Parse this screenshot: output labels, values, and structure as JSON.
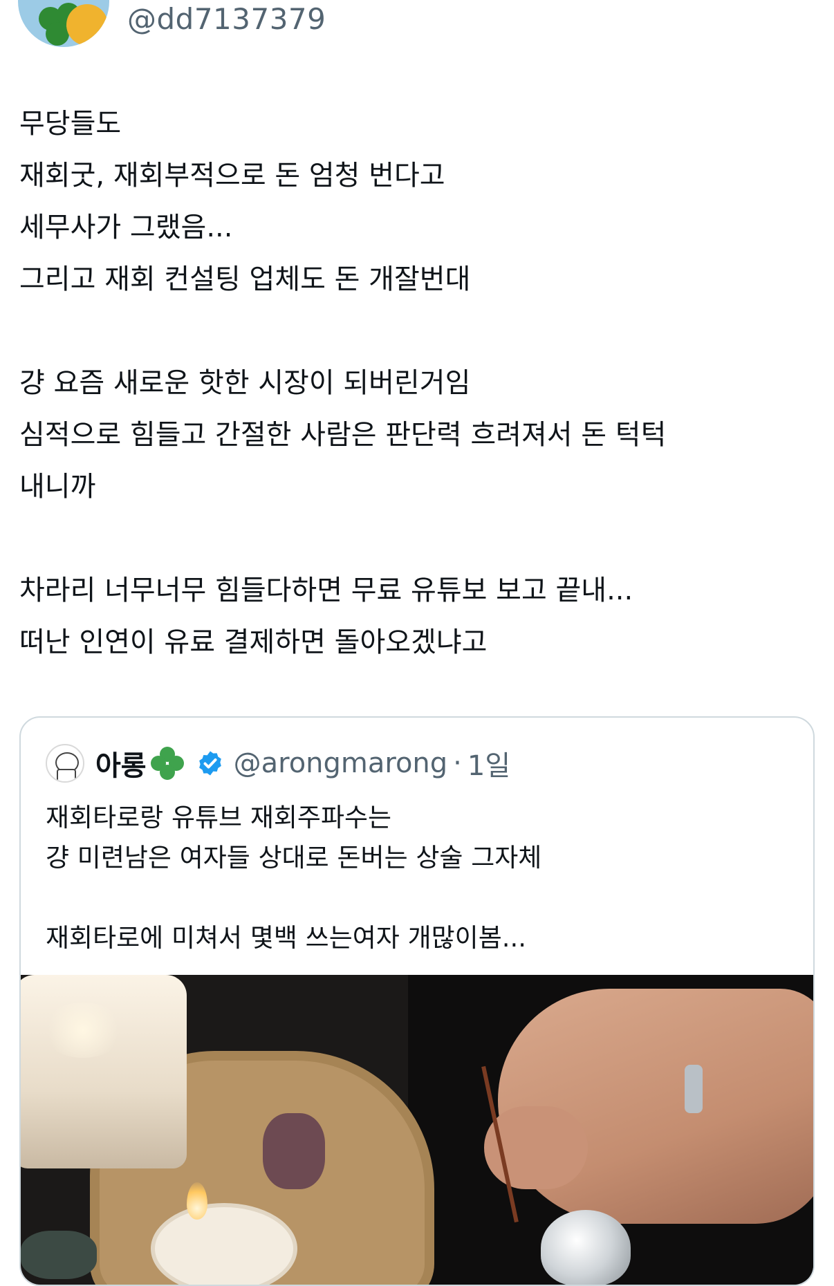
{
  "tweet": {
    "handle": "@dd7137379",
    "paragraphs": [
      [
        "무당들도",
        "재회굿, 재회부적으로 돈 엄청 번다고",
        "세무사가 그랬음...",
        "그리고 재회 컨설팅 업체도 돈 개잘번대"
      ],
      [
        "걍 요즘 새로운 핫한 시장이 되버린거임",
        "심적으로 힘들고 간절한 사람은 판단력 흐려져서 돈 턱턱",
        "내니까"
      ],
      [
        "차라리 너무너무 힘들다하면 무료 유튜보 보고 끝내...",
        "떠난 인연이 유료 결제하면 돌아오겠냐고"
      ]
    ]
  },
  "quote": {
    "name": "아롱",
    "handle": "@arongmarong",
    "separator": "·",
    "time": "1일",
    "lines": [
      "재회타로랑 유튜브 재회주파수는",
      "걍 미련남은 여자들 상대로 돈버는 상술 그자체",
      "",
      "재회타로에 미쳐서 몇백 쓰는여자 개많이봄..."
    ],
    "verified_color": "#1d9bf0",
    "icons": [
      "clover-icon",
      "verified-icon"
    ]
  }
}
